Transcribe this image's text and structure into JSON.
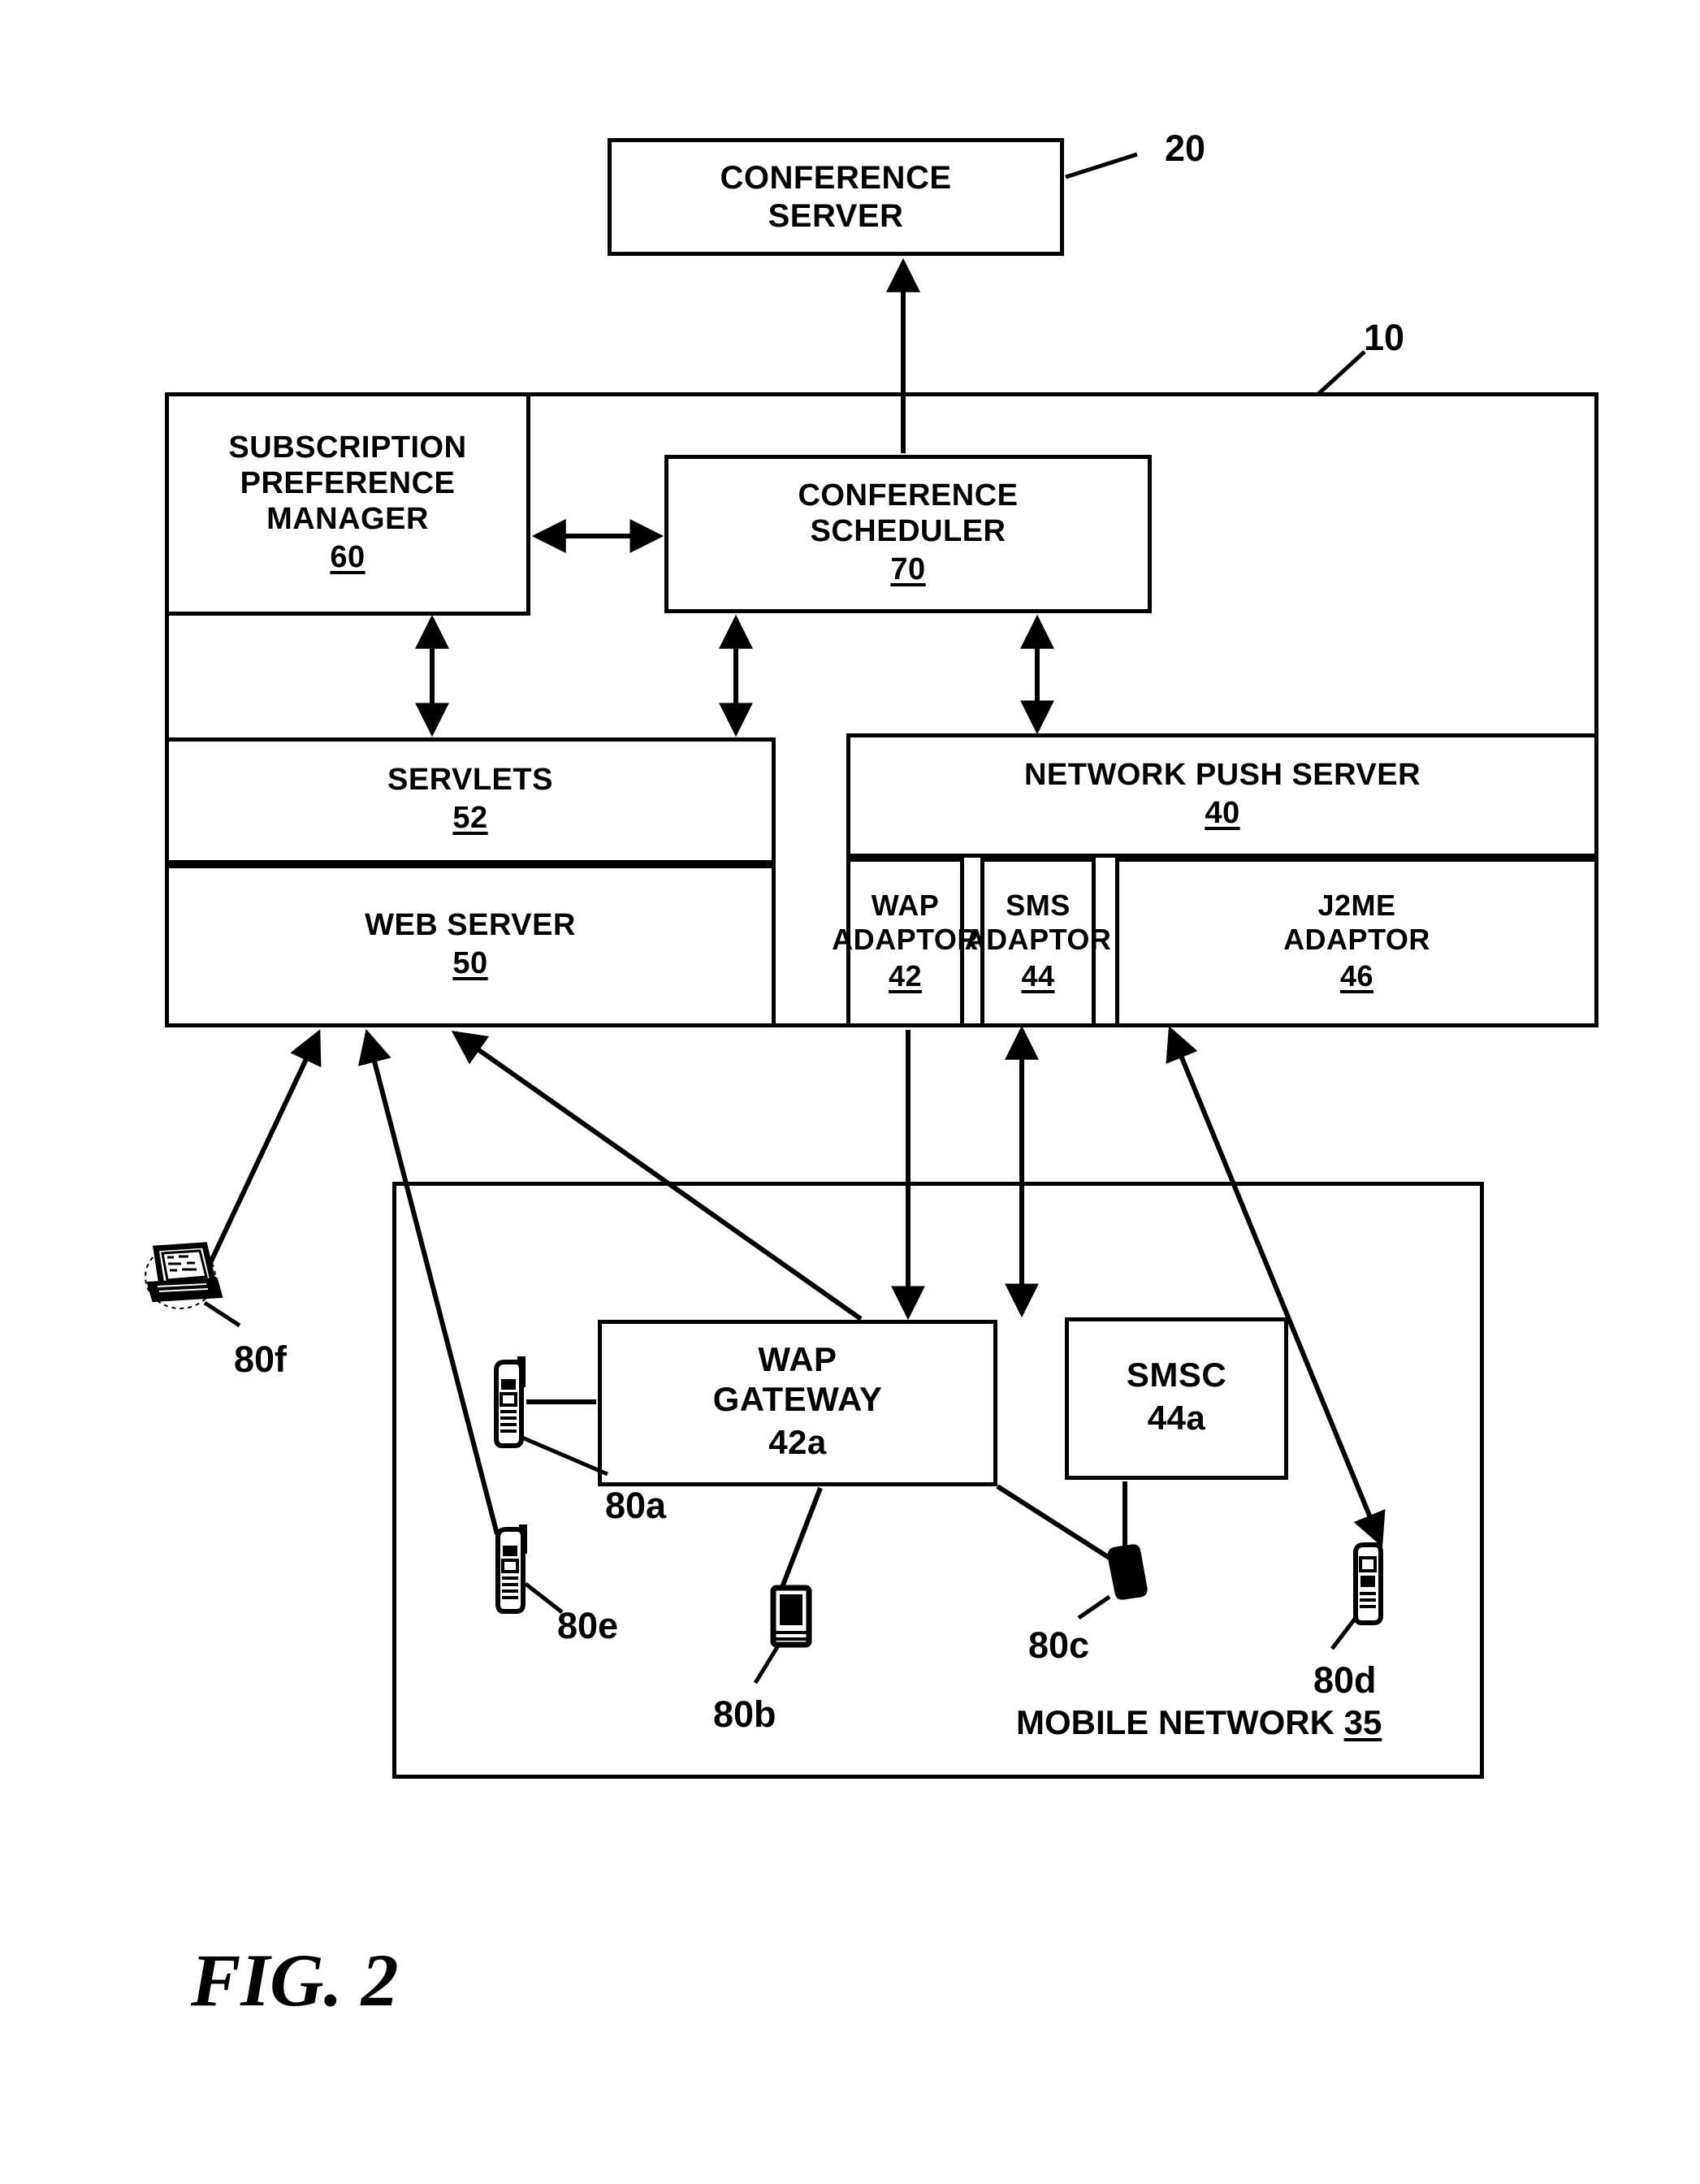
{
  "figure": {
    "caption": "FIG. 2",
    "type": "patent-block-diagram"
  },
  "blocks": {
    "conference_server": {
      "line1": "CONFERENCE",
      "line2": "SERVER",
      "ref": "20"
    },
    "system": {
      "ref": "10"
    },
    "subscription_preference_manager": {
      "line1": "SUBSCRIPTION",
      "line2": "PREFERENCE",
      "line3": "MANAGER",
      "ref": "60"
    },
    "conference_scheduler": {
      "line1": "CONFERENCE",
      "line2": "SCHEDULER",
      "ref": "70"
    },
    "servlets": {
      "line1": "SERVLETS",
      "ref": "52"
    },
    "web_server": {
      "line1": "WEB SERVER",
      "ref": "50"
    },
    "network_push_server": {
      "line1": "NETWORK PUSH SERVER",
      "ref": "40"
    },
    "wap_adaptor": {
      "line1": "WAP",
      "line2": "ADAPTOR",
      "ref": "42"
    },
    "sms_adaptor": {
      "line1": "SMS",
      "line2": "ADAPTOR",
      "ref": "44"
    },
    "j2me_adaptor": {
      "line1": "J2ME",
      "line2": "ADAPTOR",
      "ref": "46"
    },
    "wap_gateway": {
      "line1": "WAP",
      "line2": "GATEWAY",
      "ref": "42a"
    },
    "smsc": {
      "line1": "SMSC",
      "ref": "44a"
    },
    "mobile_network": {
      "label": "MOBILE NETWORK",
      "ref": "35"
    }
  },
  "devices": [
    {
      "id": "80a",
      "label": "80a",
      "kind": "mobile-phone-icon"
    },
    {
      "id": "80b",
      "label": "80b",
      "kind": "pda-icon"
    },
    {
      "id": "80c",
      "label": "80c",
      "kind": "mobile-phone-filled-icon"
    },
    {
      "id": "80d",
      "label": "80d",
      "kind": "mobile-phone-icon"
    },
    {
      "id": "80e",
      "label": "80e",
      "kind": "mobile-phone-icon"
    },
    {
      "id": "80f",
      "label": "80f",
      "kind": "laptop-computer-icon"
    }
  ],
  "colors": {
    "ink": "#000000",
    "paper": "#ffffff"
  }
}
